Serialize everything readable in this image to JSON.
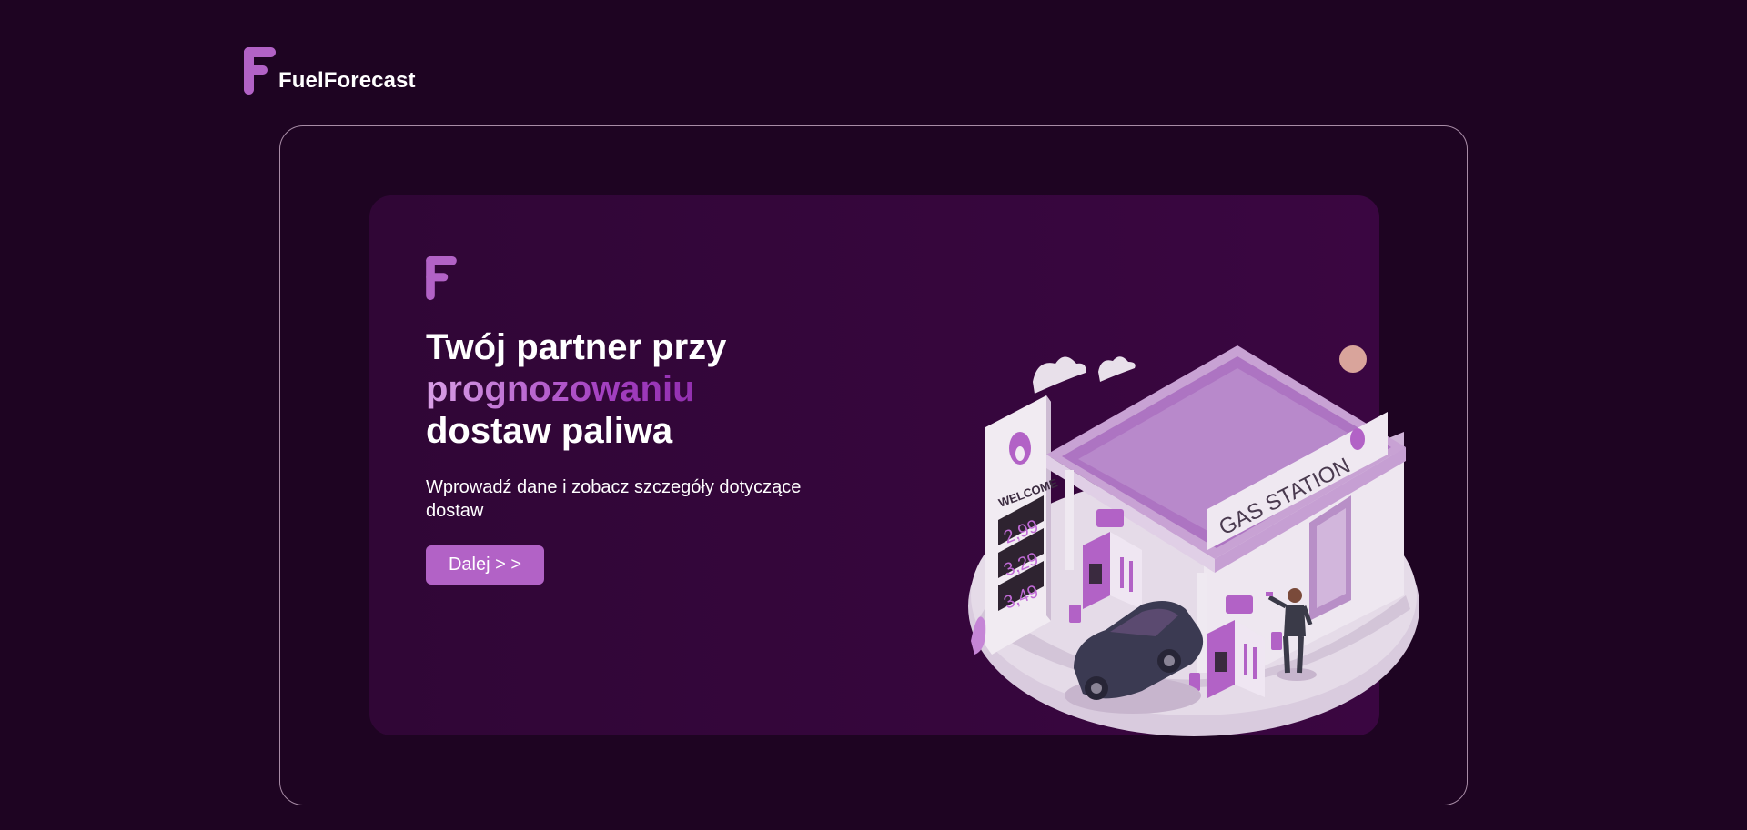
{
  "brand": {
    "name": "FuelForecast",
    "accent": "#b262c6",
    "background": "#1e0422",
    "card_background": "#35063c"
  },
  "hero": {
    "title_line1": "Twój partner przy",
    "title_highlight": "prognozowaniu",
    "title_line3": "dostaw paliwa",
    "subtitle": "Wprowadź dane i zobacz szczegóły dotyczące dostaw",
    "button_label": "Dalej > >"
  },
  "illustration": {
    "welcome_sign": "WELCOME",
    "prices": [
      "2,99",
      "3,29",
      "3,49"
    ],
    "station_sign": "GAS STATION",
    "icon": "gas-station-illustration"
  }
}
